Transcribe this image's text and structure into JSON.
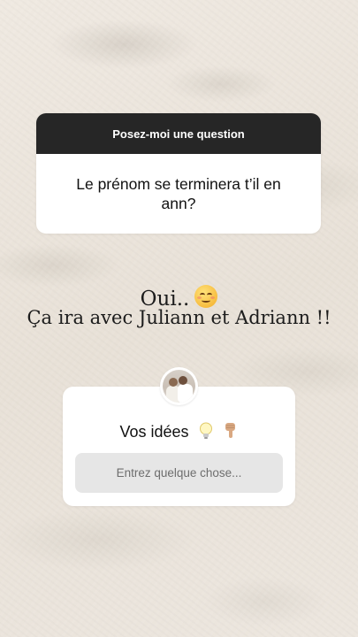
{
  "question_card": {
    "header": "Posez-moi une question",
    "question": "Le prénom se terminera t’il en ann?"
  },
  "answer": {
    "line1": "Oui..",
    "line2": "Ça ira avec Juliann et Adriann !!",
    "emoji": "relieved-face-emoji"
  },
  "ideas_sticker": {
    "title": "Vos idées",
    "emojis": [
      "light-bulb-emoji",
      "pointing-down-emoji"
    ],
    "input_placeholder": "Entrez quelque chose..."
  },
  "colors": {
    "header_bg": "#262626",
    "input_bg": "#e6e6e6",
    "background": "#ece6dd"
  }
}
